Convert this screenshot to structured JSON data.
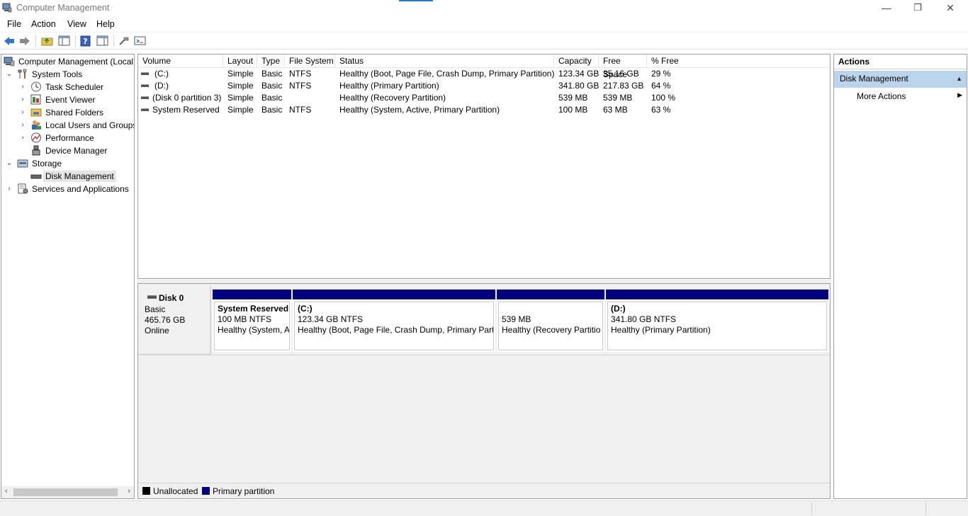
{
  "window": {
    "title": "Computer Management",
    "accent_color": "#2b7bc4",
    "controls": [
      "minimize",
      "restore",
      "close"
    ]
  },
  "menu": {
    "items": [
      "File",
      "Action",
      "View",
      "Help"
    ]
  },
  "toolbar": {
    "buttons": [
      "back-icon",
      "forward-icon",
      "up-folder-icon",
      "show-hide-tree-icon",
      "help-icon",
      "properties-icon",
      "connect-icon",
      "settings-icon"
    ]
  },
  "tree": {
    "root": "Computer Management (Local",
    "items": [
      {
        "label": "System Tools",
        "level": 1,
        "icon": "tools-icon",
        "expanded": true
      },
      {
        "label": "Task Scheduler",
        "level": 2,
        "icon": "clock-icon"
      },
      {
        "label": "Event Viewer",
        "level": 2,
        "icon": "event-viewer-icon"
      },
      {
        "label": "Shared Folders",
        "level": 2,
        "icon": "shared-folder-icon"
      },
      {
        "label": "Local Users and Groups",
        "level": 2,
        "icon": "users-icon"
      },
      {
        "label": "Performance",
        "level": 2,
        "icon": "performance-icon"
      },
      {
        "label": "Device Manager",
        "level": 2,
        "icon": "device-manager-icon"
      },
      {
        "label": "Storage",
        "level": 1,
        "icon": "storage-icon",
        "expanded": true
      },
      {
        "label": "Disk Management",
        "level": 2,
        "icon": "disk-icon",
        "selected": true
      },
      {
        "label": "Services and Applications",
        "level": 1,
        "icon": "services-icon"
      }
    ]
  },
  "volumes": {
    "columns": [
      "Volume",
      "Layout",
      "Type",
      "File System",
      "Status",
      "Capacity",
      "Free Space",
      "% Free"
    ],
    "rows": [
      {
        "volume": "(C:)",
        "layout": "Simple",
        "type": "Basic",
        "fs": "NTFS",
        "status": "Healthy (Boot, Page File, Crash Dump, Primary Partition)",
        "capacity": "123.34 GB",
        "free": "35.16 GB",
        "pct": "29 %"
      },
      {
        "volume": "(D:)",
        "layout": "Simple",
        "type": "Basic",
        "fs": "NTFS",
        "status": "Healthy (Primary Partition)",
        "capacity": "341.80 GB",
        "free": "217.83 GB",
        "pct": "64 %"
      },
      {
        "volume": "(Disk 0 partition 3)",
        "layout": "Simple",
        "type": "Basic",
        "fs": "",
        "status": "Healthy (Recovery Partition)",
        "capacity": "539 MB",
        "free": "539 MB",
        "pct": "100 %"
      },
      {
        "volume": "System Reserved",
        "layout": "Simple",
        "type": "Basic",
        "fs": "NTFS",
        "status": "Healthy (System, Active, Primary Partition)",
        "capacity": "100 MB",
        "free": "63 MB",
        "pct": "63 %"
      }
    ]
  },
  "disk": {
    "name": "Disk 0",
    "type": "Basic",
    "size": "465.76 GB",
    "state": "Online",
    "partitions": [
      {
        "name": "System Reserved",
        "size": "100 MB NTFS",
        "status": "Healthy (System, A"
      },
      {
        "name": "(C:)",
        "size": "123.34 GB NTFS",
        "status": "Healthy (Boot, Page File, Crash Dump, Primary Parti"
      },
      {
        "name": "",
        "size": "539 MB",
        "status": "Healthy (Recovery Partitio"
      },
      {
        "name": "(D:)",
        "size": "341.80 GB NTFS",
        "status": "Healthy (Primary Partition)"
      }
    ],
    "primary_color": "#00007f"
  },
  "legend": {
    "unallocated": "Unallocated",
    "primary": "Primary partition",
    "unallocated_color": "#000000",
    "primary_color": "#00007f"
  },
  "actions": {
    "header": "Actions",
    "section": "Disk Management",
    "more": "More Actions"
  }
}
